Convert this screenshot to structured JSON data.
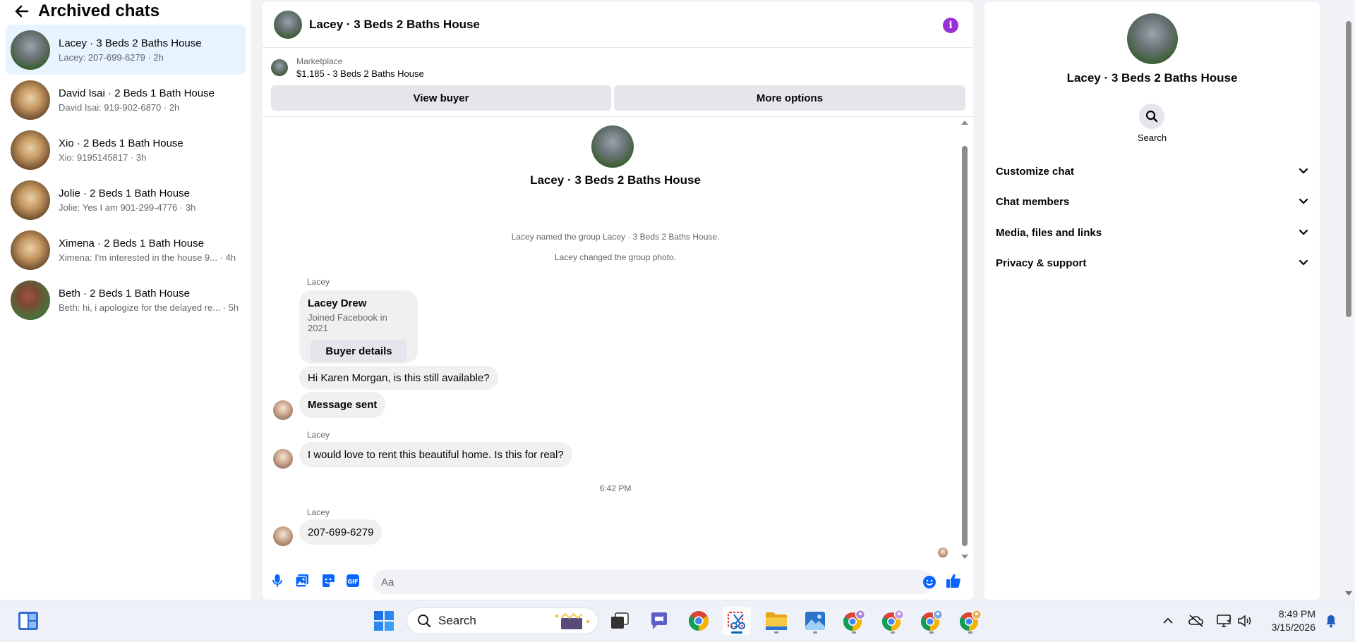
{
  "left": {
    "title": "Archived chats",
    "chats": [
      {
        "name": "Lacey · 3 Beds 2 Baths House",
        "preview": "Lacey: 207-699-6279 · 2h"
      },
      {
        "name": "David Isai · 2 Beds 1 Bath House",
        "preview": "David Isai: 919-902-6870 · 2h"
      },
      {
        "name": "Xio · 2 Beds 1 Bath House",
        "preview": "Xio: 9195145817 · 3h"
      },
      {
        "name": "Jolie · 2 Beds 1 Bath House",
        "preview": "Jolie: Yes I am 901-299-4776 · 3h"
      },
      {
        "name": "Ximena · 2 Beds 1 Bath House",
        "preview": "Ximena: I'm interested in the house 9...  · 4h"
      },
      {
        "name": "Beth · 2 Beds 1 Bath House",
        "preview": "Beth: hi, i apologize for the delayed re... · 5h"
      }
    ]
  },
  "conversation": {
    "title": "Lacey · 3 Beds 2 Baths House",
    "marketplace": {
      "label": "Marketplace",
      "listing": "$1,185 - 3 Beds 2 Baths House",
      "view_buyer": "View buyer",
      "more_options": "More options"
    },
    "thread_title": "Lacey · 3 Beds 2 Baths House",
    "system": [
      "Lacey named the group Lacey · 3 Beds 2 Baths House.",
      "Lacey changed the group photo."
    ],
    "sender1": "Lacey",
    "card": {
      "name": "Lacey Drew",
      "joined": "Joined Facebook in 2021",
      "button": "Buyer details"
    },
    "msg_available": "Hi Karen Morgan, is this still available?",
    "msg_sent": "Message sent",
    "sender2": "Lacey",
    "msg_rent": "I would love to rent this beautiful home. Is this for real?",
    "time": "6:42 PM",
    "sender3": "Lacey",
    "msg_phone": "207-699-6279",
    "composer_placeholder": "Aa"
  },
  "info_panel": {
    "title": "Lacey · 3 Beds 2 Baths House",
    "search_label": "Search",
    "sections": [
      "Customize chat",
      "Chat members",
      "Media, files and links",
      "Privacy & support"
    ]
  },
  "taskbar": {
    "search_label": "Search",
    "time": "8:49 PM",
    "date": "3/15/2026"
  },
  "colors": {
    "accent": "#0866ff",
    "active_chat_bg": "#e7f3ff",
    "info_icon": "#9b30d9"
  }
}
